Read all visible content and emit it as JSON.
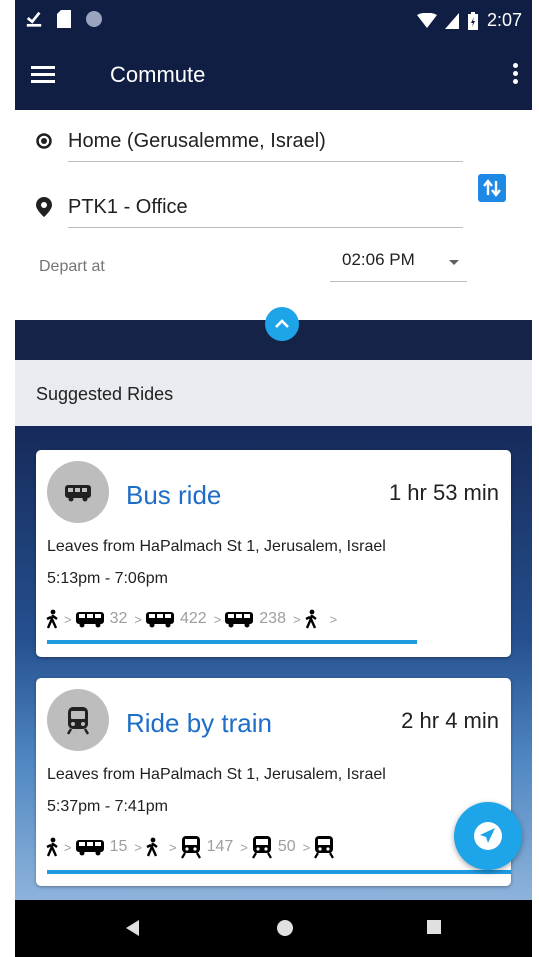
{
  "status_bar": {
    "time": "2:07"
  },
  "app_bar": {
    "title": "Commute"
  },
  "form": {
    "from": "Home (Gerusalemme, Israel)",
    "to": "PTK1 - Office",
    "depart_label": "Depart at",
    "depart_time": "02:06 PM"
  },
  "suggested": {
    "title": "Suggested Rides"
  },
  "rides": [
    {
      "title": "Bus ride",
      "duration": "1 hr 53 min",
      "leaves": "Leaves from HaPalmach St 1, Jerusalem, Israel",
      "times": "5:13pm - 7:06pm",
      "legs": [
        {
          "mode": "walk-icon"
        },
        {
          "mode": "bus-icon",
          "line": "32"
        },
        {
          "mode": "bus-icon",
          "line": "422"
        },
        {
          "mode": "bus-icon",
          "line": "238"
        },
        {
          "mode": "walk-icon"
        }
      ],
      "separator": ">"
    },
    {
      "title": "Ride by train",
      "duration": "2 hr 4 min",
      "leaves": "Leaves from HaPalmach St 1, Jerusalem, Israel",
      "times": "5:37pm - 7:41pm",
      "legs": [
        {
          "mode": "walk-icon"
        },
        {
          "mode": "bus-icon",
          "line": "15"
        },
        {
          "mode": "walk-icon"
        },
        {
          "mode": "train-icon",
          "line": "147"
        },
        {
          "mode": "train-icon",
          "line": "50"
        },
        {
          "mode": "train-icon"
        }
      ],
      "separator": ">"
    }
  ],
  "colors": {
    "primary_dark": "#0f1e42",
    "accent": "#1ea4e9",
    "link": "#1e6dc8"
  }
}
